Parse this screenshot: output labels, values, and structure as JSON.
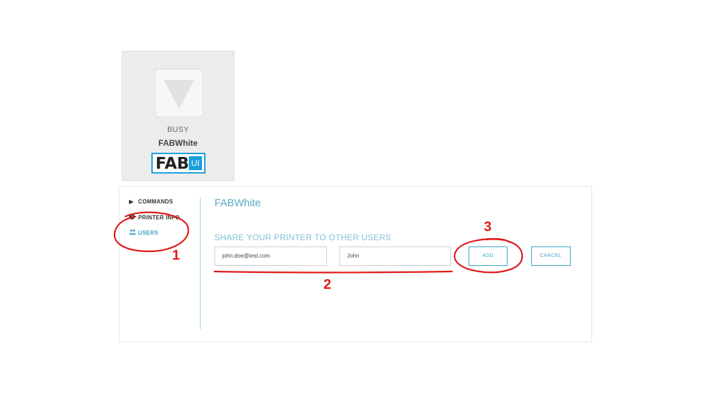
{
  "printer_card": {
    "status": "BUSY",
    "name": "FABWhite",
    "logo_text": "FAB",
    "logo_badge": "UI",
    "icon": "triangle-down-icon"
  },
  "sidebar": {
    "items": [
      {
        "label": "COMMANDS",
        "icon": "play-icon"
      },
      {
        "label": "PRINTER INFO",
        "icon": "info-icon"
      },
      {
        "label": "USERS",
        "icon": "users-icon"
      }
    ]
  },
  "main": {
    "title": "FABWhite",
    "share_heading": "SHARE YOUR PRINTER TO OTHER USERS",
    "email_value": "john.doe@test.com",
    "name_value": "John",
    "add_label": "ADD",
    "cancel_label": "CANCEL"
  },
  "annotations": {
    "step1": "1",
    "step2": "2",
    "step3": "3",
    "color": "#e01818"
  },
  "colors": {
    "accent": "#3aa3c6",
    "logo_blue": "#1aa0db",
    "card_bg": "#ececec"
  }
}
